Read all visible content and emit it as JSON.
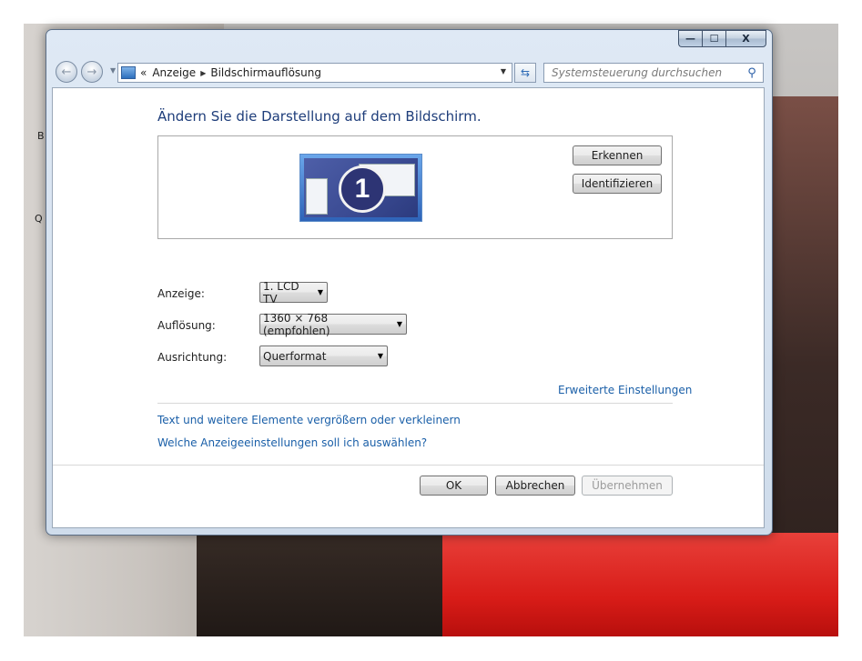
{
  "desktop": {
    "labels": [
      "B",
      "Q"
    ]
  },
  "window": {
    "caption": {
      "minimize": "—",
      "maximize": "☐",
      "close": "X"
    },
    "nav": {
      "back_glyph": "←",
      "forward_glyph": "→",
      "overflow": "«",
      "breadcrumb": [
        "Anzeige",
        "Bildschirmauflösung"
      ],
      "search_placeholder": "Systemsteuerung durchsuchen"
    }
  },
  "main": {
    "heading": "Ändern Sie die Darstellung auf dem Bildschirm.",
    "monitor_number": "1",
    "buttons": {
      "detect": "Erkennen",
      "identify": "Identifizieren"
    },
    "settings": [
      {
        "label": "Anzeige:",
        "value": "1. LCD TV"
      },
      {
        "label": "Auflösung:",
        "value": "1360 × 768 (empfohlen)"
      },
      {
        "label": "Ausrichtung:",
        "value": "Querformat"
      }
    ],
    "advanced_link": "Erweiterte Einstellungen",
    "links": [
      "Text und weitere Elemente vergrößern oder verkleinern",
      "Welche Anzeigeeinstellungen soll ich auswählen?"
    ],
    "footer": {
      "ok": "OK",
      "cancel": "Abbrechen",
      "apply": "Übernehmen"
    }
  }
}
